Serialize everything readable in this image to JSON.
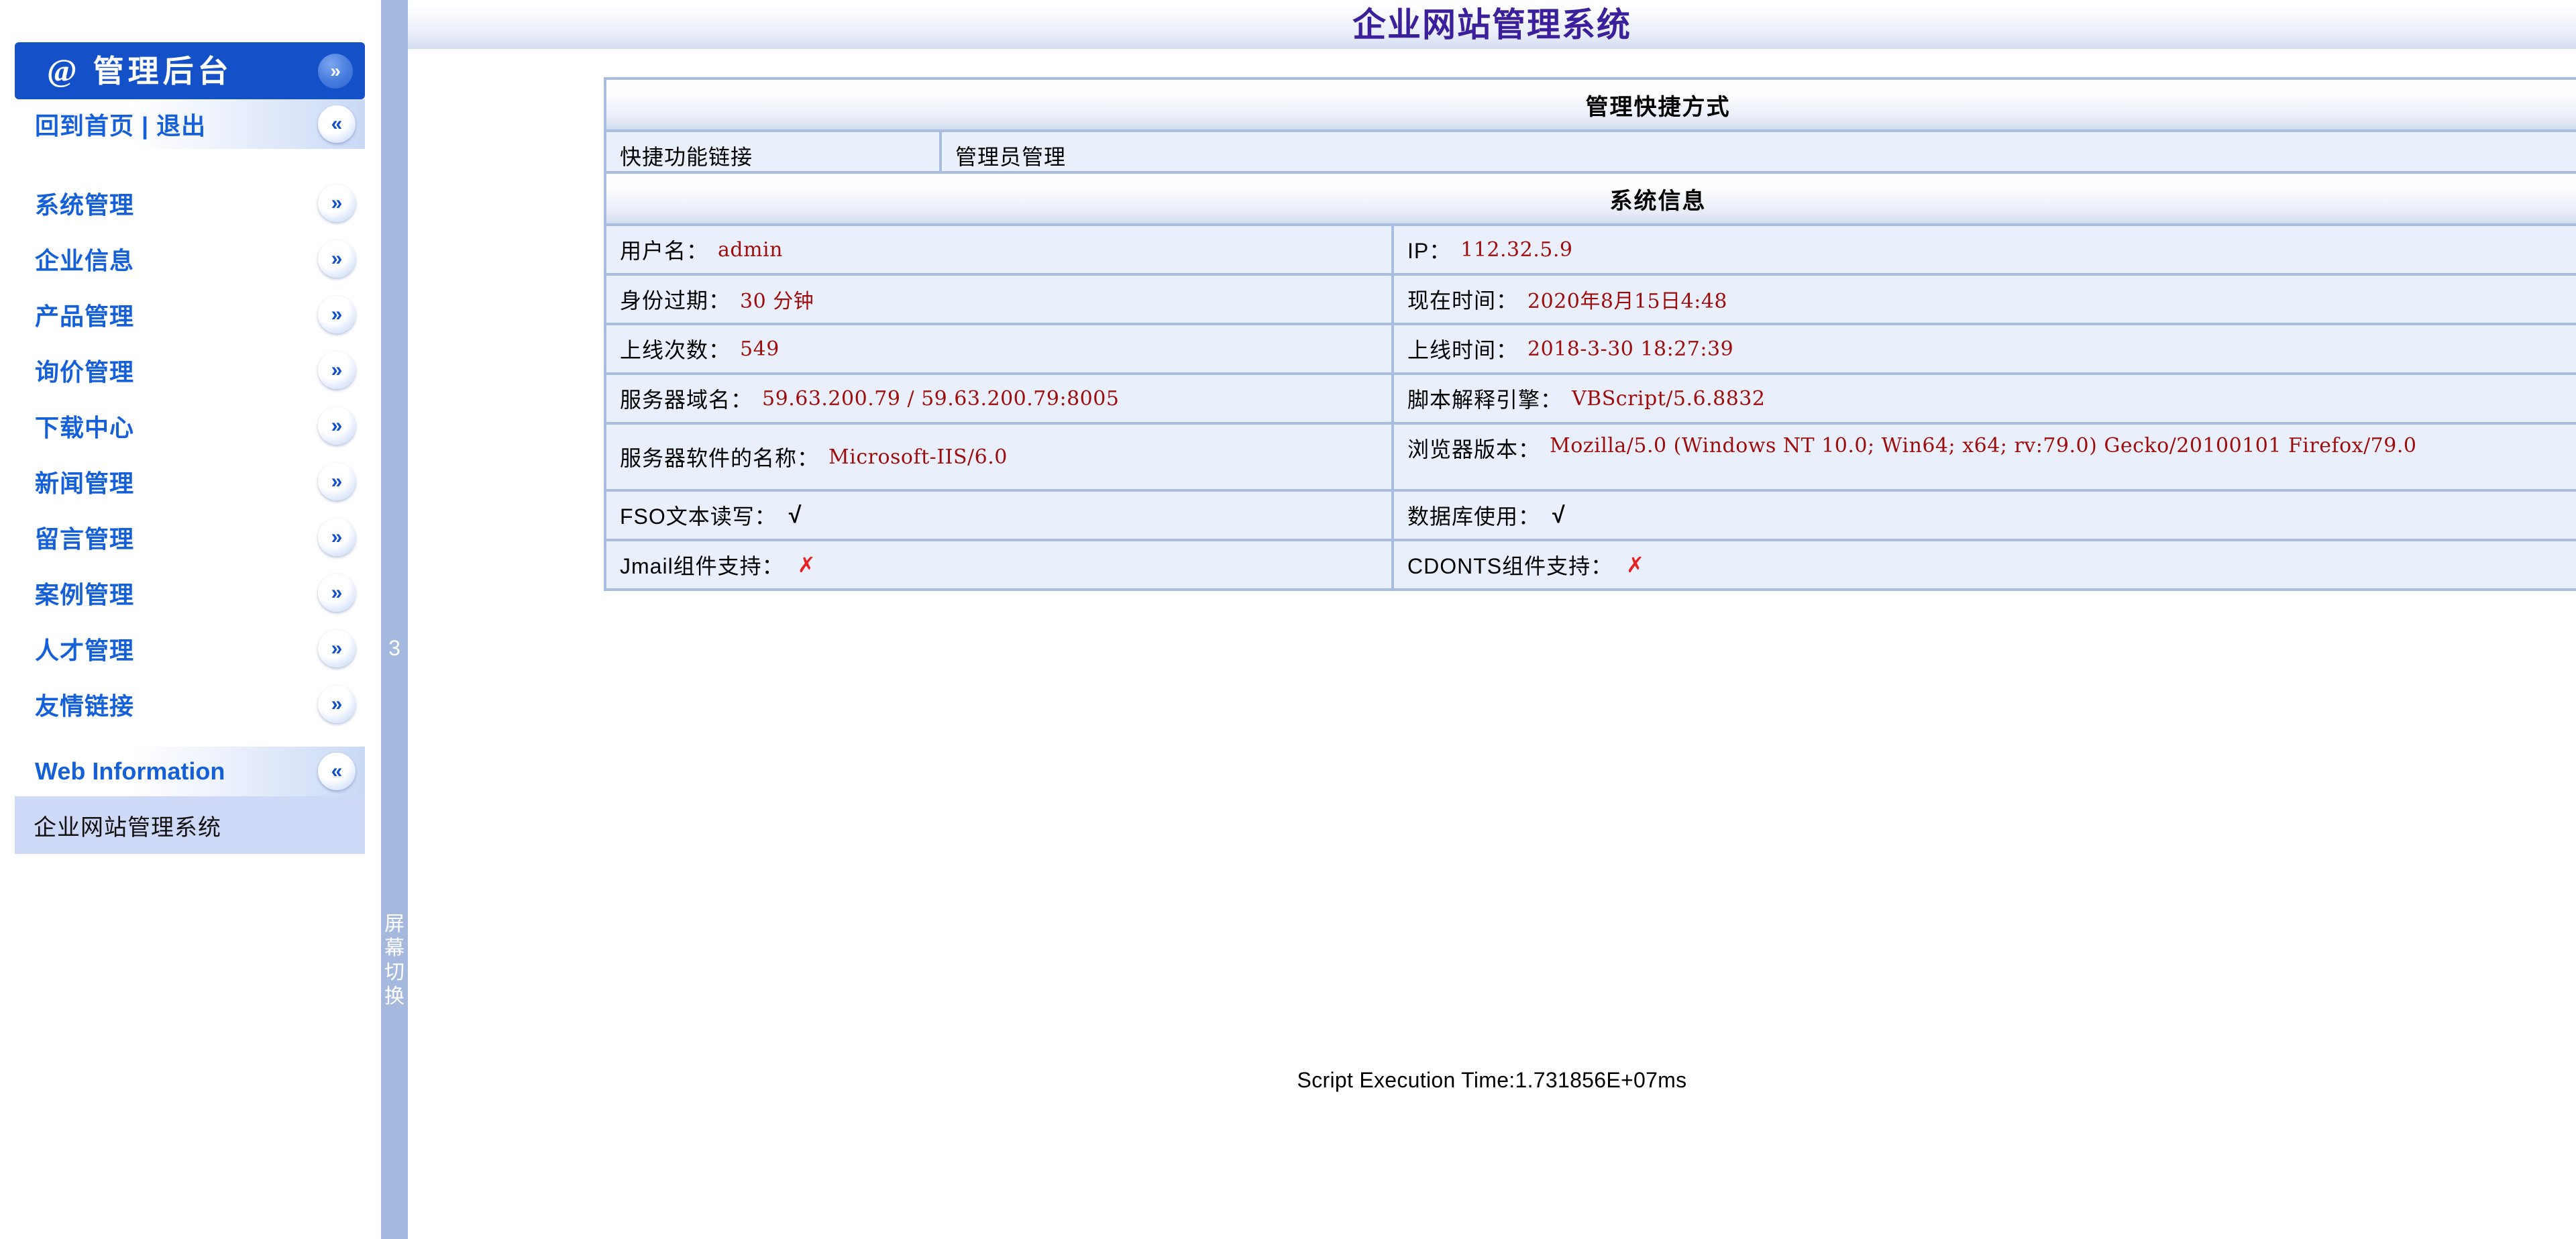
{
  "header": {
    "title": "企业网站管理系统"
  },
  "sidebar": {
    "brand": {
      "at_symbol": "@",
      "title": "管理后台",
      "collapse_icon": "chevron-double-down"
    },
    "top_links": {
      "label": "回到首页 | 退出",
      "icon": "chevron-double-left"
    },
    "items": [
      {
        "label": "系统管理",
        "icon": "chevron-double-down"
      },
      {
        "label": "企业信息",
        "icon": "chevron-double-down"
      },
      {
        "label": "产品管理",
        "icon": "chevron-double-down"
      },
      {
        "label": "询价管理",
        "icon": "chevron-double-down"
      },
      {
        "label": "下载中心",
        "icon": "chevron-double-down"
      },
      {
        "label": "新闻管理",
        "icon": "chevron-double-down"
      },
      {
        "label": "留言管理",
        "icon": "chevron-double-down"
      },
      {
        "label": "案例管理",
        "icon": "chevron-double-down"
      },
      {
        "label": "人才管理",
        "icon": "chevron-double-down"
      },
      {
        "label": "友情链接",
        "icon": "chevron-double-down"
      },
      {
        "label": "Web Information",
        "icon": "chevron-double-left"
      }
    ],
    "current_item": "企业网站管理系统"
  },
  "splitter": {
    "number": "3",
    "vertical_label": [
      "屏",
      "幕",
      "切",
      "换"
    ]
  },
  "shortcut_panel": {
    "title": "管理快捷方式",
    "key": "快捷功能链接",
    "value": "管理员管理"
  },
  "sysinfo_panel": {
    "title": "系统信息",
    "rows": [
      {
        "left_label": "用户名：",
        "left_value": "admin",
        "right_label": "IP：",
        "right_value": "112.32.5.9"
      },
      {
        "left_label": "身份过期：",
        "left_value": "30 分钟",
        "right_label": "现在时间：",
        "right_value": "2020年8月15日4:48"
      },
      {
        "left_label": "上线次数：",
        "left_value": "549",
        "right_label": "上线时间：",
        "right_value": "2018-3-30 18:27:39"
      },
      {
        "left_label": "服务器域名：",
        "left_value": "59.63.200.79 / 59.63.200.79:8005",
        "right_label": "脚本解释引擎：",
        "right_value": "VBScript/5.6.8832"
      },
      {
        "left_label": "服务器软件的名称：",
        "left_value": "Microsoft-IIS/6.0",
        "right_label": "浏览器版本：",
        "right_value": "Mozilla/5.0 (Windows NT 10.0; Win64; x64; rv:79.0) Gecko/20100101 Firefox/79.0"
      },
      {
        "left_label": "FSO文本读写：",
        "left_mark": "√",
        "left_mark_state": "ok",
        "right_label": "数据库使用：",
        "right_mark": "√",
        "right_mark_state": "ok"
      },
      {
        "left_label": "Jmail组件支持：",
        "left_mark": "✗",
        "left_mark_state": "no",
        "right_label": "CDONTS组件支持：",
        "right_mark": "✗",
        "right_mark_state": "no"
      }
    ]
  },
  "footer": {
    "exec_time": "Script Execution Time:1.731856E+07ms"
  },
  "colors": {
    "brand_blue": "#1450c8",
    "link_blue": "#1560d8",
    "title_purple": "#3b1f9b",
    "panel_border": "#a8bde0",
    "cell_bg": "#eaf0fb",
    "value_red": "#9e0d0d",
    "splitter": "#a5b8dd",
    "mark_no_red": "#e82020"
  }
}
